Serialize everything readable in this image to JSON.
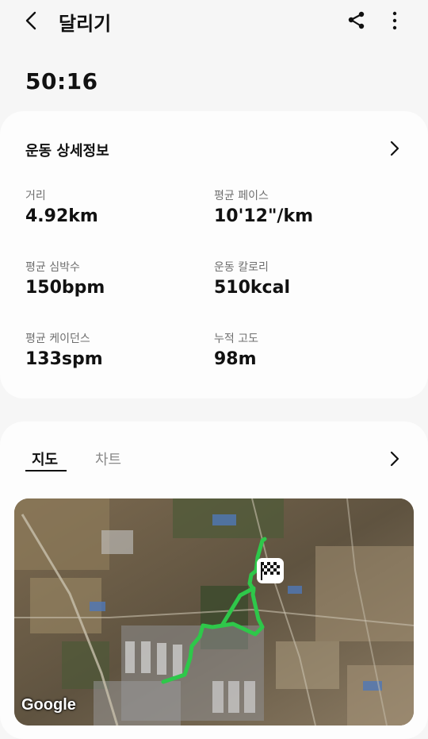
{
  "header": {
    "title": "달리기"
  },
  "summary": {
    "duration": "50:16"
  },
  "details": {
    "section_title": "운동 상세정보",
    "metrics": [
      {
        "label": "거리",
        "value": "4.92km"
      },
      {
        "label": "평균 페이스",
        "value": "10'12\"/km"
      },
      {
        "label": "평균 심박수",
        "value": "150bpm"
      },
      {
        "label": "운동 칼로리",
        "value": "510kcal"
      },
      {
        "label": "평균 케이던스",
        "value": "133spm"
      },
      {
        "label": "누적 고도",
        "value": "98m"
      }
    ]
  },
  "map_section": {
    "tabs": [
      {
        "label": "지도",
        "selected": true
      },
      {
        "label": "차트",
        "selected": false
      }
    ],
    "map_attribution": "Google",
    "route_color": "#2ec84a"
  },
  "icons": {
    "back": "chevron-left-icon",
    "share": "share-icon",
    "more": "more-vertical-icon",
    "details_arrow": "chevron-right-icon",
    "map_arrow": "chevron-right-icon",
    "finish": "checkered-flag-icon"
  }
}
